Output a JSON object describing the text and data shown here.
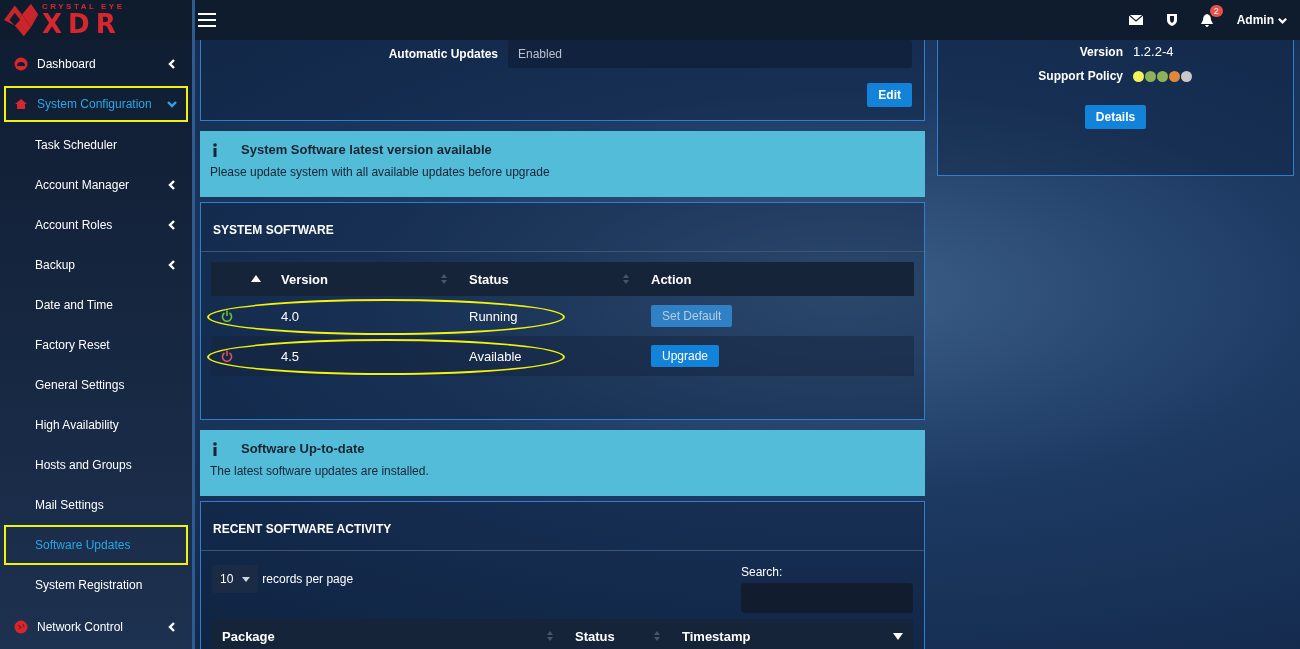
{
  "brand": {
    "tagline": "CRYSTAL EYE",
    "name": "XDR"
  },
  "sidebar": {
    "items": [
      {
        "label": "Dashboard",
        "expanded": false,
        "selected": false,
        "annotated": false
      },
      {
        "label": "System Configuration",
        "expanded": true,
        "selected": true,
        "annotated": true,
        "children": [
          {
            "label": "Task Scheduler",
            "submenu": false,
            "selected": false,
            "annotated": false
          },
          {
            "label": "Account Manager",
            "submenu": true,
            "selected": false,
            "annotated": false
          },
          {
            "label": "Account Roles",
            "submenu": true,
            "selected": false,
            "annotated": false
          },
          {
            "label": "Backup",
            "submenu": true,
            "selected": false,
            "annotated": false
          },
          {
            "label": "Date and Time",
            "submenu": false,
            "selected": false,
            "annotated": false
          },
          {
            "label": "Factory Reset",
            "submenu": false,
            "selected": false,
            "annotated": false
          },
          {
            "label": "General Settings",
            "submenu": false,
            "selected": false,
            "annotated": false
          },
          {
            "label": "High Availability",
            "submenu": false,
            "selected": false,
            "annotated": false
          },
          {
            "label": "Hosts and Groups",
            "submenu": false,
            "selected": false,
            "annotated": false
          },
          {
            "label": "Mail Settings",
            "submenu": false,
            "selected": false,
            "annotated": false
          },
          {
            "label": "Software Updates",
            "submenu": false,
            "selected": true,
            "annotated": true
          },
          {
            "label": "System Registration",
            "submenu": false,
            "selected": false,
            "annotated": false
          }
        ]
      },
      {
        "label": "Network Control",
        "expanded": false,
        "selected": false,
        "annotated": false
      }
    ]
  },
  "topbar": {
    "notifications": "2",
    "user": "Admin"
  },
  "settings": {
    "field_label": "Automatic Updates",
    "field_value": "Enabled",
    "button": "Edit"
  },
  "alerts": [
    {
      "title": "System Software latest version available",
      "message": "Please update system with all available updates before upgrade"
    },
    {
      "title": "Software Up-to-date",
      "message": "The latest software updates are installed."
    }
  ],
  "system_software": {
    "title": "SYSTEM SOFTWARE",
    "columns": [
      {
        "sorted": true,
        "descending": false
      },
      {
        "label": "Version",
        "sorted": false
      },
      {
        "label": "Status",
        "sorted": false
      },
      {
        "label": "Action"
      }
    ],
    "rows": [
      {
        "running": true,
        "version": "4.0",
        "status": "Running",
        "action": "Set Default",
        "action_disabled": true,
        "annotated": true
      },
      {
        "running": false,
        "version": "4.5",
        "status": "Available",
        "action": "Upgrade",
        "action_disabled": false,
        "annotated": true
      }
    ]
  },
  "activity": {
    "title": "RECENT SOFTWARE ACTIVITY",
    "page_size": "10",
    "page_size_label": "records per page",
    "search_label": "Search:",
    "columns": [
      {
        "label": "Package",
        "sorted": false
      },
      {
        "label": "Status",
        "sorted": false
      },
      {
        "label": "Timestamp",
        "sorted": true,
        "descending": true
      }
    ]
  },
  "info_card": {
    "rows": [
      {
        "label": "Version",
        "value": "1.2.2-4"
      }
    ],
    "policy_label": "Support Policy",
    "policy_dots": [
      {
        "color": "#f3f35a"
      },
      {
        "color": "#8db356"
      },
      {
        "color": "#8db356"
      },
      {
        "color": "#e0873a"
      },
      {
        "color": "#c9c9c9"
      }
    ],
    "button": "Details"
  }
}
